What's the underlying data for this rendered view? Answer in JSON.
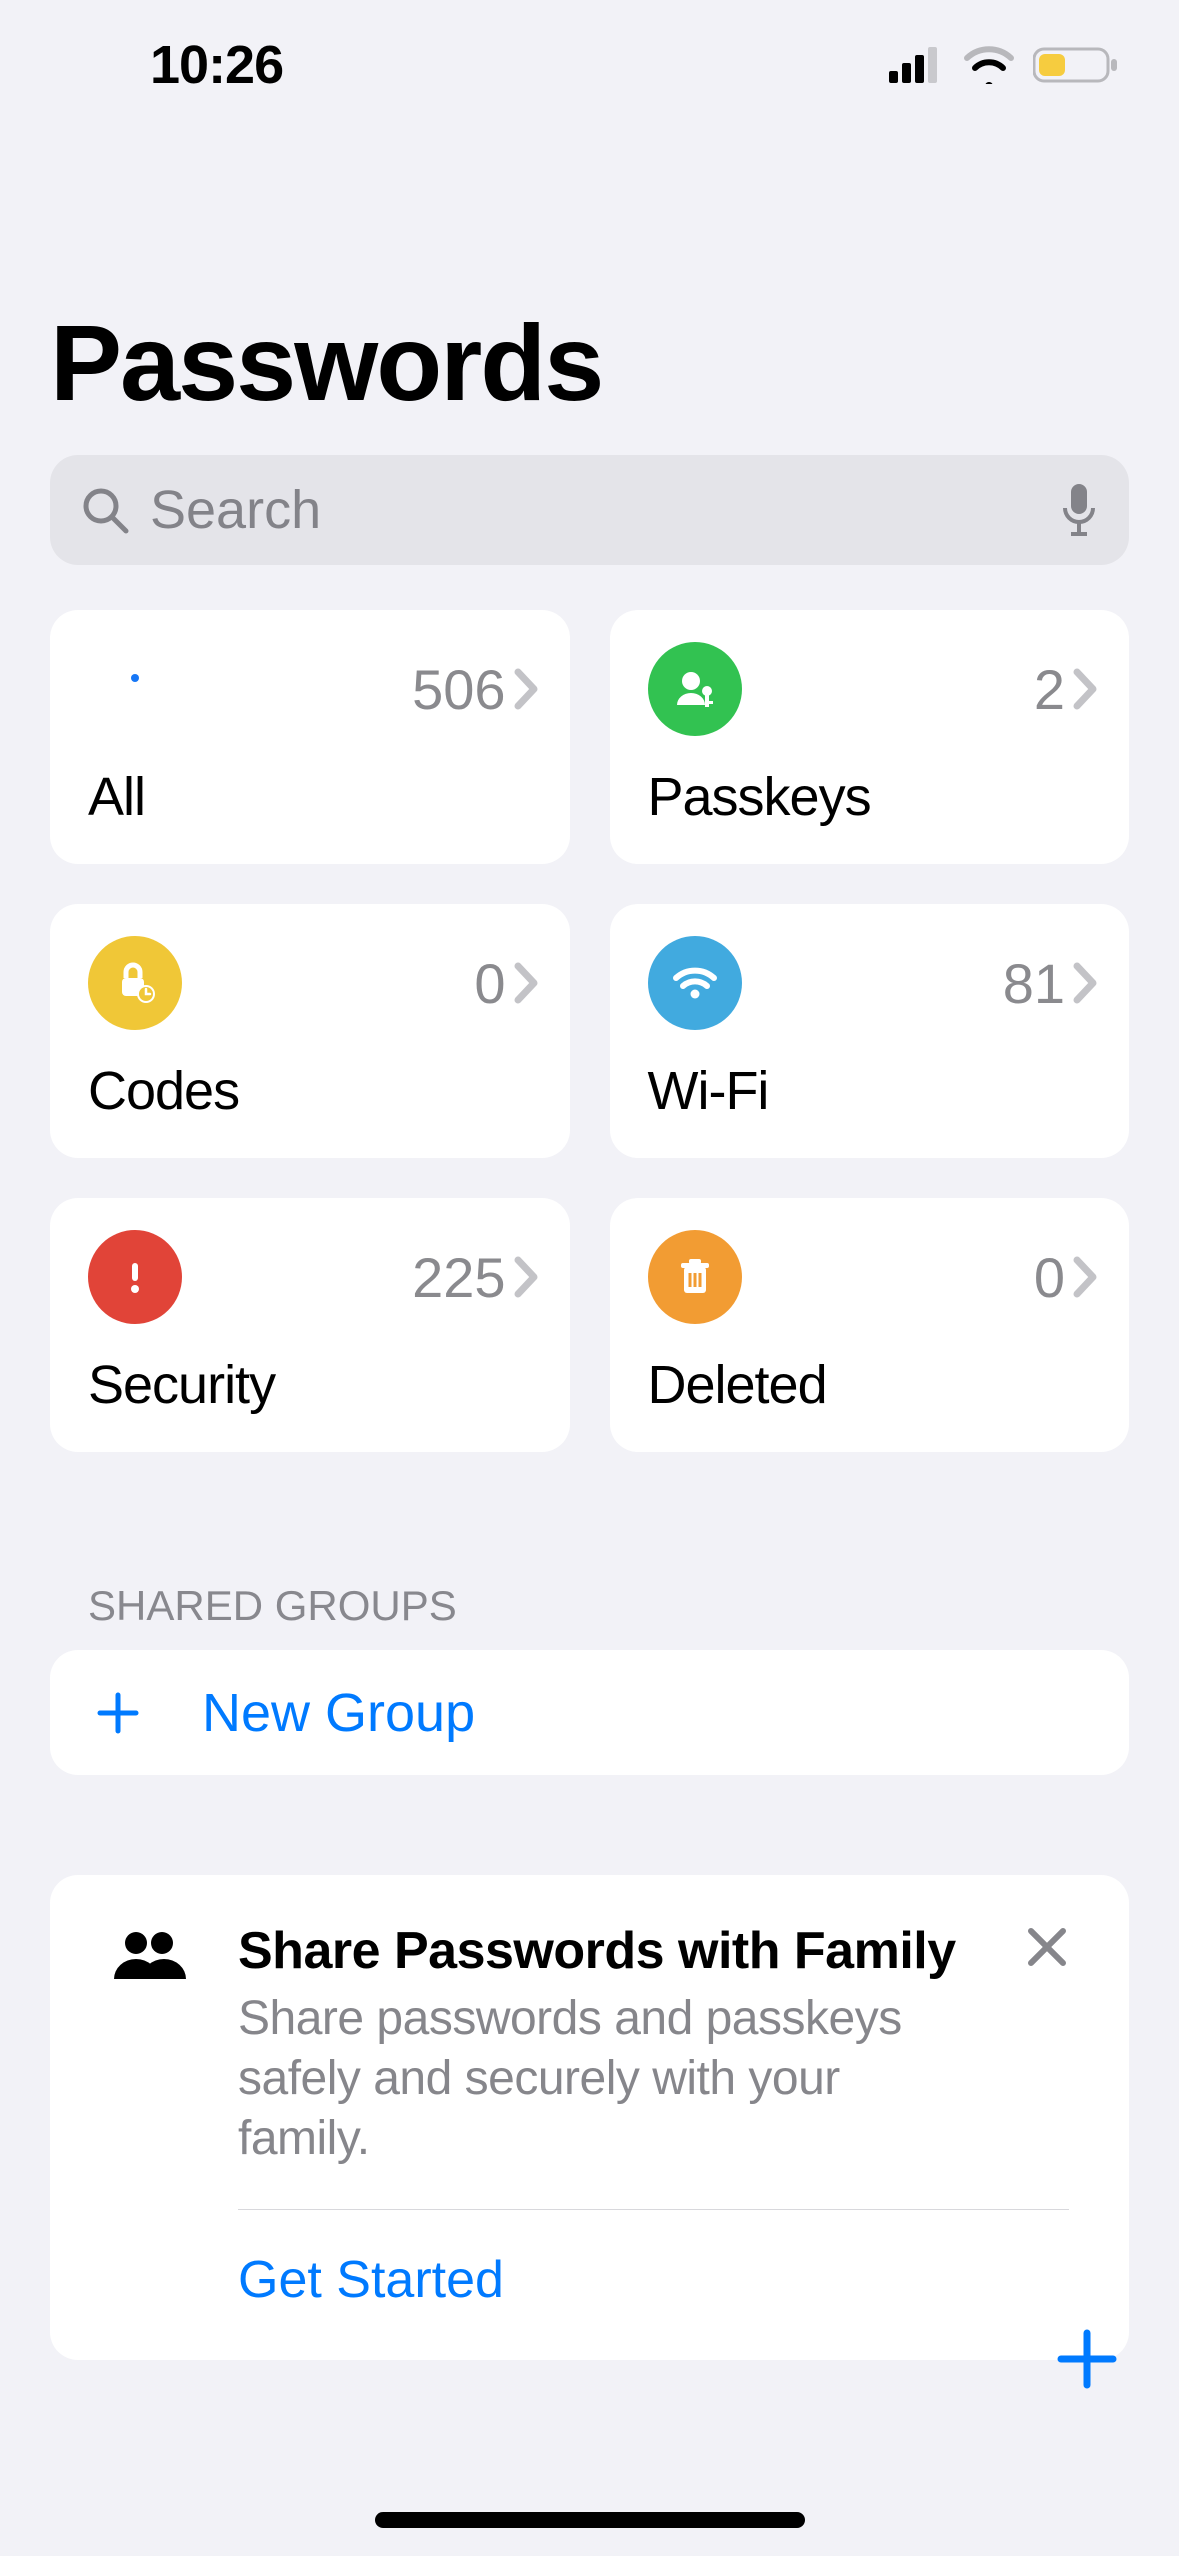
{
  "status": {
    "time": "10:26"
  },
  "title": "Passwords",
  "search": {
    "placeholder": "Search"
  },
  "cards": {
    "all": {
      "label": "All",
      "count": "506",
      "color": "#1777f6"
    },
    "passkeys": {
      "label": "Passkeys",
      "count": "2",
      "color": "#32c251"
    },
    "codes": {
      "label": "Codes",
      "count": "0",
      "color": "#f0c737"
    },
    "wifi": {
      "label": "Wi-Fi",
      "count": "81",
      "color": "#41aadf"
    },
    "security": {
      "label": "Security",
      "count": "225",
      "color": "#e14438"
    },
    "deleted": {
      "label": "Deleted",
      "count": "0",
      "color": "#f29c33"
    }
  },
  "sections": {
    "shared_groups": {
      "header": "SHARED GROUPS",
      "new_group_label": "New Group"
    }
  },
  "promo": {
    "title": "Share Passwords with Family",
    "subtitle": "Share passwords and passkeys safely and securely with your family.",
    "action": "Get Started"
  },
  "accent": "#007aff"
}
